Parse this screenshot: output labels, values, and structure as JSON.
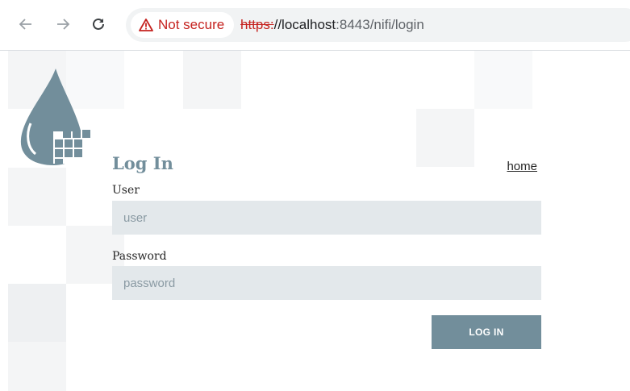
{
  "browser": {
    "security_label": "Not secure",
    "url_scheme": "https:",
    "url_host": "//localhost",
    "url_port": ":8443",
    "url_path": "/nifi/login"
  },
  "login": {
    "title": "Log In",
    "home_link": "home",
    "user_label": "User",
    "user_placeholder": "user",
    "user_value": "",
    "password_label": "Password",
    "password_placeholder": "password",
    "password_value": "",
    "submit_label": "LOG IN"
  },
  "colors": {
    "accent": "#728e9b",
    "input_bg": "#e3e8eb",
    "tile_bg": "#f4f5f6",
    "warning": "#c5221f"
  },
  "icons": {
    "back": "arrow-left-icon",
    "forward": "arrow-right-icon",
    "reload": "reload-icon",
    "warning": "warning-triangle-icon",
    "logo": "nifi-drop-logo-icon"
  }
}
